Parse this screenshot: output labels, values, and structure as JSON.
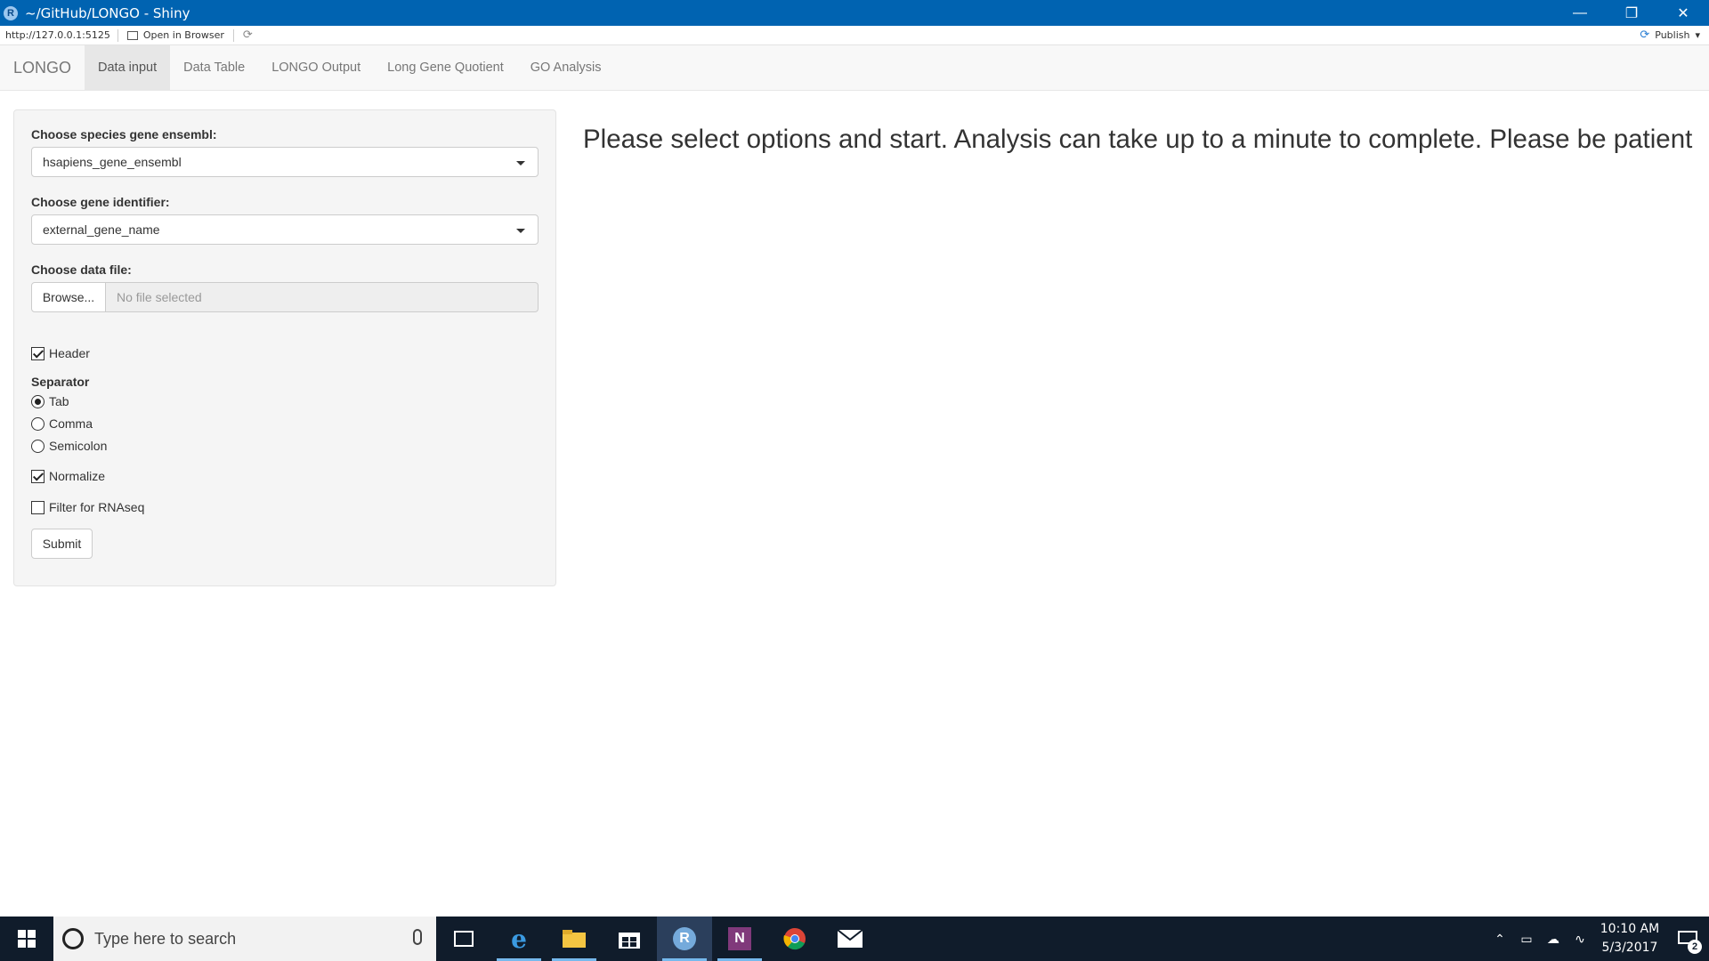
{
  "window": {
    "title": "~/GitHub/LONGO - Shiny",
    "app_icon_letter": "R",
    "controls": [
      "minimize-icon",
      "restore-icon",
      "close-icon"
    ]
  },
  "address_bar": {
    "url": "http://127.0.0.1:5125",
    "open_in_browser": "Open in Browser",
    "publish": "Publish"
  },
  "navbar": {
    "brand": "LONGO",
    "tabs": [
      {
        "label": "Data input",
        "active": true
      },
      {
        "label": "Data Table",
        "active": false
      },
      {
        "label": "LONGO Output",
        "active": false
      },
      {
        "label": "Long Gene Quotient",
        "active": false
      },
      {
        "label": "GO Analysis",
        "active": false
      }
    ]
  },
  "sidebar": {
    "species_label": "Choose species gene ensembl:",
    "species_value": "hsapiens_gene_ensembl",
    "identifier_label": "Choose gene identifier:",
    "identifier_value": "external_gene_name",
    "datafile_label": "Choose data file:",
    "browse_label": "Browse...",
    "file_placeholder": "No file selected",
    "header_label": "Header",
    "header_checked": true,
    "separator_label": "Separator",
    "separator_options": [
      {
        "label": "Tab",
        "selected": true
      },
      {
        "label": "Comma",
        "selected": false
      },
      {
        "label": "Semicolon",
        "selected": false
      }
    ],
    "normalize_label": "Normalize",
    "normalize_checked": true,
    "filter_label": "Filter for RNAseq",
    "filter_checked": false,
    "submit_label": "Submit"
  },
  "main": {
    "message": "Please select options and start. Analysis can take up to a minute to complete. Please be patient"
  },
  "taskbar": {
    "search_placeholder": "Type here to search",
    "apps": [
      "task-view-icon",
      "edge-icon",
      "file-explorer-icon",
      "store-icon",
      "rstudio-icon",
      "onenote-icon",
      "chrome-icon",
      "mail-icon"
    ],
    "active_app": "rstudio-icon",
    "time": "10:10 AM",
    "date": "5/3/2017",
    "notification_count": "2"
  }
}
